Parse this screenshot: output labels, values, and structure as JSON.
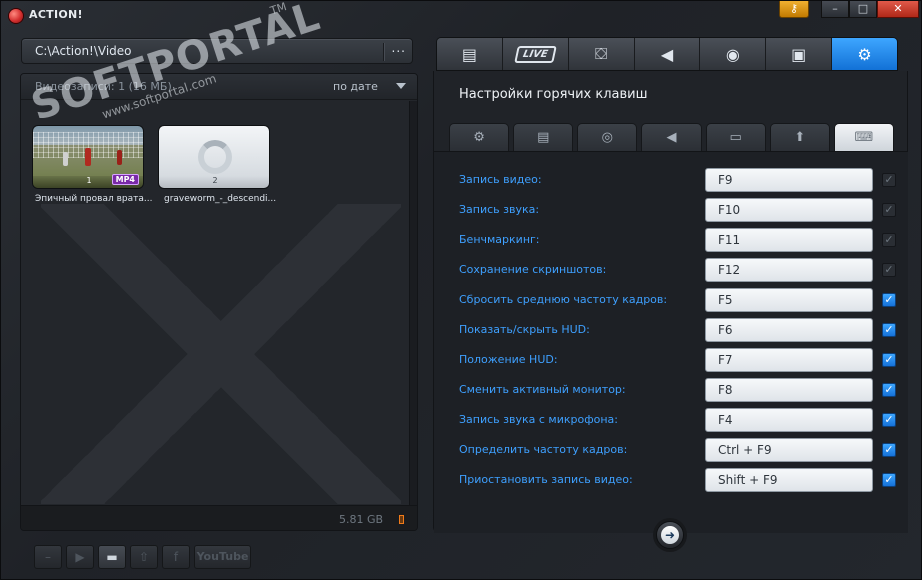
{
  "titlebar": {
    "app_title": "ACTION!",
    "key_icon": "key-icon",
    "minimize": "–",
    "maximize": "□",
    "close": "✕"
  },
  "library": {
    "path": "C:\\Action!\\Video",
    "browse_label": "...",
    "caption": "Видеозаписи: 1 (16 МБ)",
    "sort": "по дате",
    "disk_free": "5.81 GB",
    "items": [
      {
        "index": "1",
        "format": "MP4",
        "title": "Эпичный провал врата..."
      },
      {
        "index": "2",
        "format": "",
        "title": "graveworm_-_descendi..."
      }
    ]
  },
  "bottom_toolbar": {
    "youtube_label": "YouTube"
  },
  "watermark": {
    "brand": "SOFTPORTAL",
    "url": "www.softportal.com",
    "tm": "TM"
  },
  "main_tabs": [
    {
      "name": "video",
      "icon": "film-icon"
    },
    {
      "name": "live",
      "label": "LIVE"
    },
    {
      "name": "gaming",
      "icon": "gamepad-icon"
    },
    {
      "name": "audio",
      "icon": "speaker-icon"
    },
    {
      "name": "benchmark",
      "icon": "stopwatch-icon"
    },
    {
      "name": "screenshot",
      "icon": "camera-icon"
    },
    {
      "name": "settings",
      "icon": "gear-icon",
      "active": true
    }
  ],
  "settings": {
    "title": "Настройки горячих клавиш",
    "subtabs": [
      {
        "icon": "gear-icon"
      },
      {
        "icon": "film-icon"
      },
      {
        "icon": "webcam-icon"
      },
      {
        "icon": "speaker-icon"
      },
      {
        "icon": "monitor-icon"
      },
      {
        "icon": "upload-icon"
      },
      {
        "icon": "keyboard-icon",
        "active": true
      }
    ],
    "hotkeys": [
      {
        "label": "Запись видео:",
        "key": "F9",
        "enabled": false
      },
      {
        "label": "Запись звука:",
        "key": "F10",
        "enabled": false
      },
      {
        "label": "Бенчмаркинг:",
        "key": "F11",
        "enabled": false
      },
      {
        "label": "Сохранение скриншотов:",
        "key": "F12",
        "enabled": false
      },
      {
        "label": "Сбросить среднюю частоту кадров:",
        "key": "F5",
        "enabled": true
      },
      {
        "label": "Показать/скрыть HUD:",
        "key": "F6",
        "enabled": true
      },
      {
        "label": "Положение HUD:",
        "key": "F7",
        "enabled": true
      },
      {
        "label": "Сменить активный монитор:",
        "key": "F8",
        "enabled": true
      },
      {
        "label": "Запись звука с микрофона:",
        "key": "F4",
        "enabled": true
      },
      {
        "label": "Определить частоту кадров:",
        "key": "Ctrl + F9",
        "enabled": true
      },
      {
        "label": "Приостановить запись видео:",
        "key": "Shift + F9",
        "enabled": true
      }
    ]
  },
  "colors": {
    "accent": "#1e8cf0",
    "label_blue": "#3ea0ff",
    "record_red": "#d32f2f"
  }
}
